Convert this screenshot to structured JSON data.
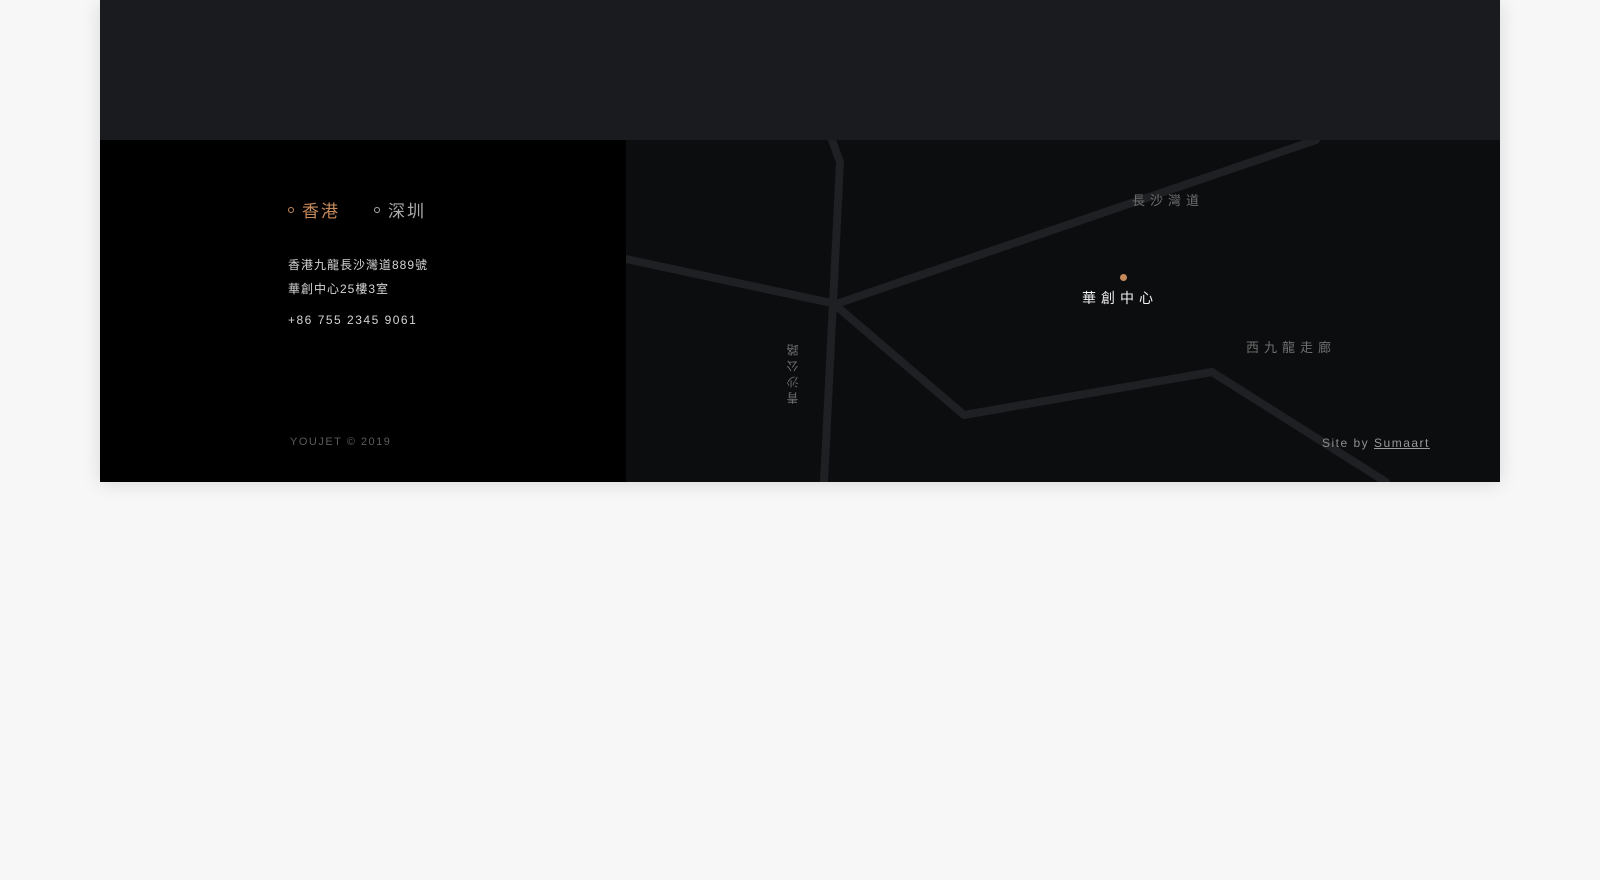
{
  "colors": {
    "accent": "#c6895a",
    "top_band": "#1a1b1f",
    "footer_left_bg": "#000000",
    "map_bg": "#0c0d0f",
    "road": "#1f2023"
  },
  "city_tabs": [
    {
      "label": "香港",
      "active": true
    },
    {
      "label": "深圳",
      "active": false
    }
  ],
  "address": {
    "line1": "香港九龍長沙灣道889號",
    "line2": "華創中心25樓3室"
  },
  "phone": "+86 755 2345 9061",
  "copyright": "YOUJET © 2019",
  "map": {
    "labels": {
      "changsha": "長沙灣道",
      "center": "華創中心",
      "westkowloon": "西九龍走廊",
      "qingsha": "青沙公路"
    }
  },
  "credit": {
    "prefix": "Site by",
    "link": "Sumaart"
  }
}
